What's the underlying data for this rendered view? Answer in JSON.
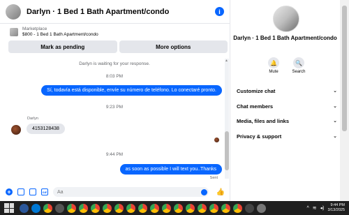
{
  "header": {
    "title": "Darlyn · 1 Bed 1 Bath Apartment/condo"
  },
  "marketplace": {
    "source": "Marketplace",
    "listing": "$800 - 1 Bed 1 Bath Apartment/condo"
  },
  "actions": {
    "pending_label": "Mark as pending",
    "more_label": "More options"
  },
  "messages": {
    "waiting_note": "Darlyn is waiting for your response.",
    "time1": "8:03 PM",
    "out1": "Sí, todavía está disponible, envíe su número de teléfono. Lo conectaré pronto.",
    "time2": "9:23 PM",
    "sender": "Darlyn",
    "in1": "4153128438",
    "time3": "9:44 PM",
    "out2": "as soon as possible I will text you..Thanks",
    "sent_label": "Sent"
  },
  "composer": {
    "placeholder": "Aa"
  },
  "details": {
    "title": "Darlyn · 1 Bed 1 Bath Apartment/condo",
    "mute_label": "Mute",
    "search_label": "Search",
    "sections": [
      "Customize chat",
      "Chat members",
      "Media, files and links",
      "Privacy & support"
    ]
  },
  "taskbar": {
    "time": "9:44 PM",
    "date": "3/13/2025"
  },
  "colors": {
    "accent": "#0866ff",
    "bubble_in": "#e4e6eb",
    "taskbar": "#1f1f1f"
  },
  "icons": [
    "info-icon",
    "plus-icon",
    "photo-icon",
    "sticker-icon",
    "gif-icon",
    "emoji-icon",
    "like-icon",
    "bell-icon",
    "search-icon",
    "chevron-down-icon"
  ]
}
